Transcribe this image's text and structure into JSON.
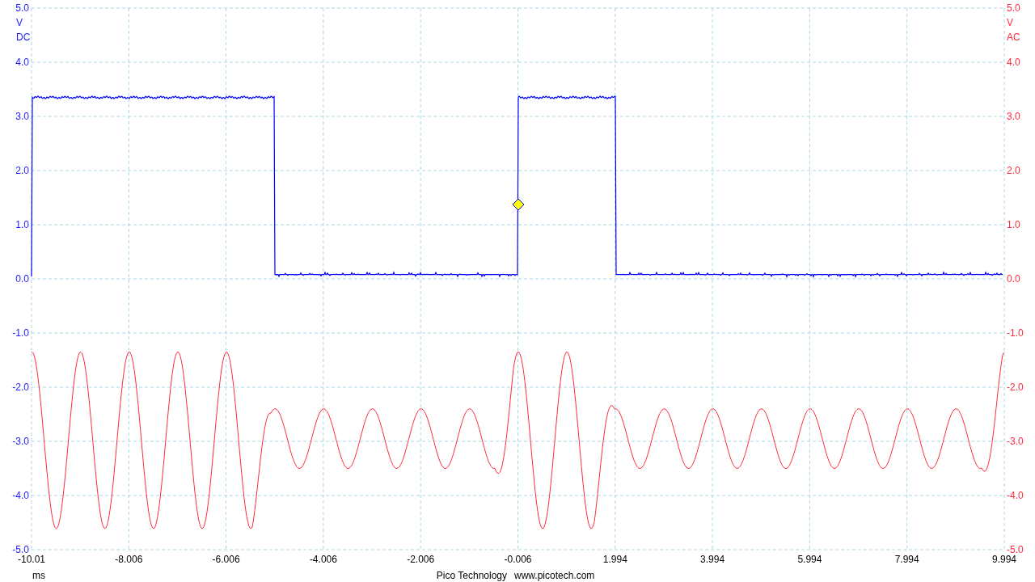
{
  "channels": [
    {
      "unit": "V",
      "coupling": "DC",
      "color": "#1a1aff",
      "ticks": [
        "5.0",
        "4.0",
        "3.0",
        "2.0",
        "1.0",
        "0.0",
        "-1.0",
        "-2.0",
        "-3.0",
        "-4.0",
        "-5.0"
      ]
    },
    {
      "unit": "V",
      "coupling": "AC",
      "color": "#ff2a3c",
      "ticks": [
        "5.0",
        "4.0",
        "3.0",
        "2.0",
        "1.0",
        "0.0",
        "-1.0",
        "-2.0",
        "-3.0",
        "-4.0",
        "-5.0"
      ]
    }
  ],
  "x_axis": {
    "unit": "ms",
    "ticks": [
      "-10.01",
      "-8.006",
      "-6.006",
      "-4.006",
      "-2.006",
      "-0.006",
      "1.994",
      "3.994",
      "5.994",
      "7.994",
      "9.994"
    ]
  },
  "footer": {
    "company": "Pico Technology",
    "website": "www.picotech.com"
  }
}
